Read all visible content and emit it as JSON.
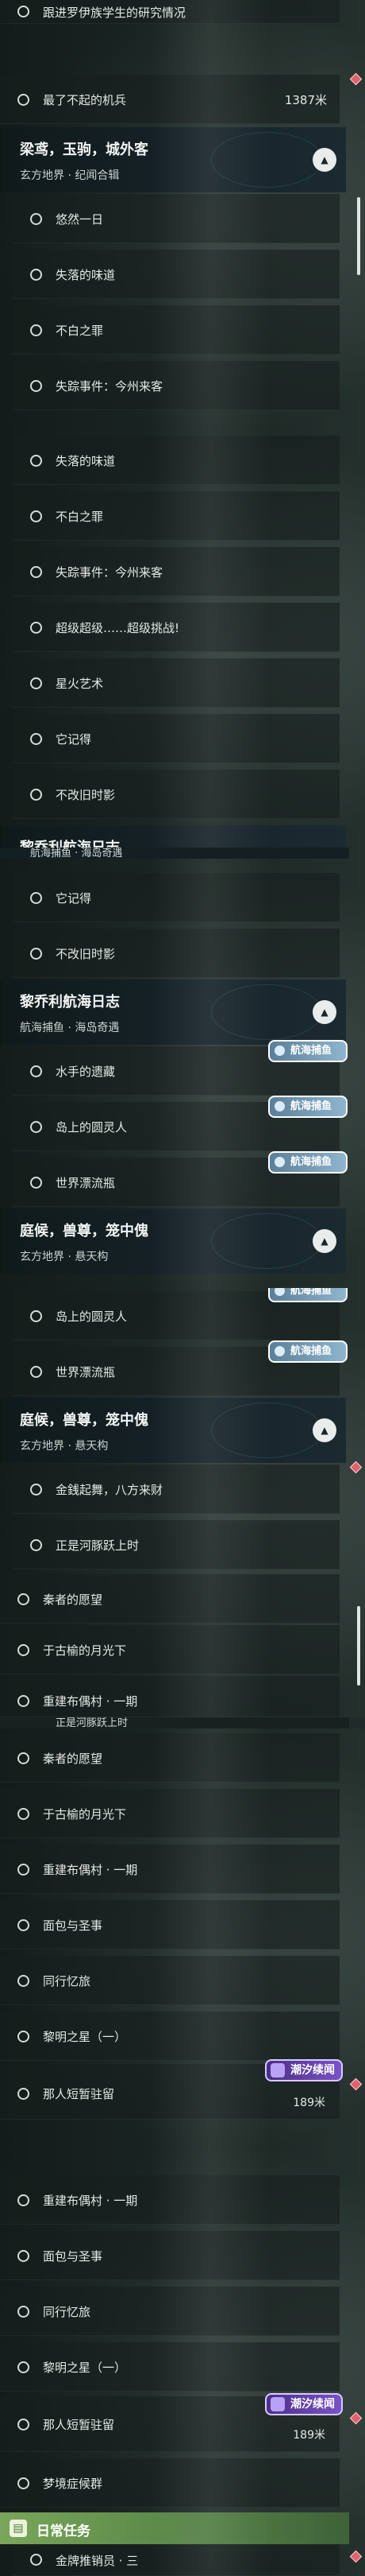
{
  "badges": {
    "hanghai": "航海捕鱼",
    "chaoxi": "潮汐续闻"
  },
  "quests": {
    "luoyi": "跟进罗伊族学生的研究情况",
    "jibing": "最了不起的机兵",
    "youran": "悠然一日",
    "shiluo": "失落的味道",
    "buba": "不白之罪",
    "shizong": "失踪事件：今州来客",
    "chaoji": "超级超级……超级挑战!",
    "xinghuo": "星火艺术",
    "taji": "它记得",
    "buchi": "不改旧时影",
    "shuishou": "水手的遗藏",
    "daoshang": "岛上的圆灵人",
    "shijie": "世界漂流瓶",
    "jinqian": "金銭起舞，八方来财",
    "zhengshi": "正是河豚跃上时",
    "qinke": "秦者的愿望",
    "yuguyu": "于古榆的月光下",
    "chongjian": "重建布偶村 · 一期",
    "mianbao": "面包与圣事",
    "tongxing": "同行忆旅",
    "liming": "黎明之星（一）",
    "naren": "那人短暂驻留",
    "mengjing": "梦境症候群",
    "jinpang": "金牌推销员 · 三"
  },
  "distances": {
    "jibing": "1387米",
    "naren": "189米"
  },
  "groups": {
    "liangying": {
      "title": "梁鸢，玉驹，城外客",
      "subtitle": "玄方地界 · 纪闻合辑"
    },
    "liqiao": {
      "title": "黎乔利航海日志",
      "subtitle": "航海捕鱼 · 海岛奇遇"
    },
    "tinghou": {
      "title": "庭候，兽尊，笼中傀",
      "subtitle": "玄方地界 · 悬天构"
    }
  },
  "daily": {
    "label": "日常任务",
    "icon": "calendar-icon"
  },
  "truncated": {
    "liqiao_sub": "航海捕鱼 · 海岛奇遇",
    "zhengshi_cut": "正是河豚跃上时",
    "daoshang_cut": "岛上的圆灵人"
  },
  "colors": {
    "quest_marker": "#e0616c",
    "daily_bar": "#7aa65a",
    "chaoxi_badge": "#7a52c7",
    "hanghai_badge": "#8fb6cf"
  }
}
